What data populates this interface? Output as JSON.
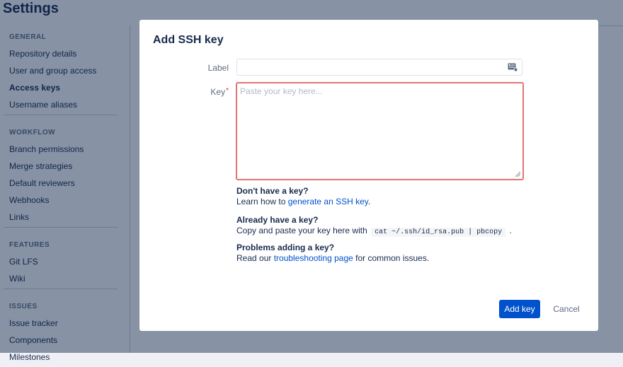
{
  "page": {
    "title": "Settings"
  },
  "sidebar": {
    "sections": [
      {
        "heading": "GENERAL",
        "items": [
          {
            "label": "Repository details"
          },
          {
            "label": "User and group access"
          },
          {
            "label": "Access keys",
            "active": true
          },
          {
            "label": "Username aliases"
          }
        ]
      },
      {
        "heading": "WORKFLOW",
        "items": [
          {
            "label": "Branch permissions"
          },
          {
            "label": "Merge strategies"
          },
          {
            "label": "Default reviewers"
          },
          {
            "label": "Webhooks"
          },
          {
            "label": "Links"
          }
        ]
      },
      {
        "heading": "FEATURES",
        "items": [
          {
            "label": "Git LFS"
          },
          {
            "label": "Wiki"
          }
        ]
      },
      {
        "heading": "ISSUES",
        "items": [
          {
            "label": "Issue tracker"
          },
          {
            "label": "Components"
          },
          {
            "label": "Milestones"
          }
        ]
      }
    ]
  },
  "dialog": {
    "title": "Add SSH key",
    "label_field": {
      "label": "Label",
      "value": "",
      "placeholder": ""
    },
    "key_field": {
      "label": "Key",
      "required_marker": "*",
      "value": "",
      "placeholder": "Paste your key here..."
    },
    "help": [
      {
        "title": "Don't have a key?",
        "prefix": "Learn how to ",
        "link": "generate an SSH key",
        "suffix": "."
      },
      {
        "title": "Already have a key?",
        "prefix": "Copy and paste your key here with",
        "code": "cat ~/.ssh/id_rsa.pub | pbcopy",
        "suffix": "."
      },
      {
        "title": "Problems adding a key?",
        "prefix": "Read our ",
        "link": "troubleshooting page",
        "suffix": " for common issues."
      }
    ],
    "buttons": {
      "submit": "Add key",
      "cancel": "Cancel"
    }
  },
  "colors": {
    "primary": "#0052cc",
    "error_border": "#e57373",
    "required": "#de350b",
    "text": "#172b4d",
    "muted": "#5e6c84"
  }
}
